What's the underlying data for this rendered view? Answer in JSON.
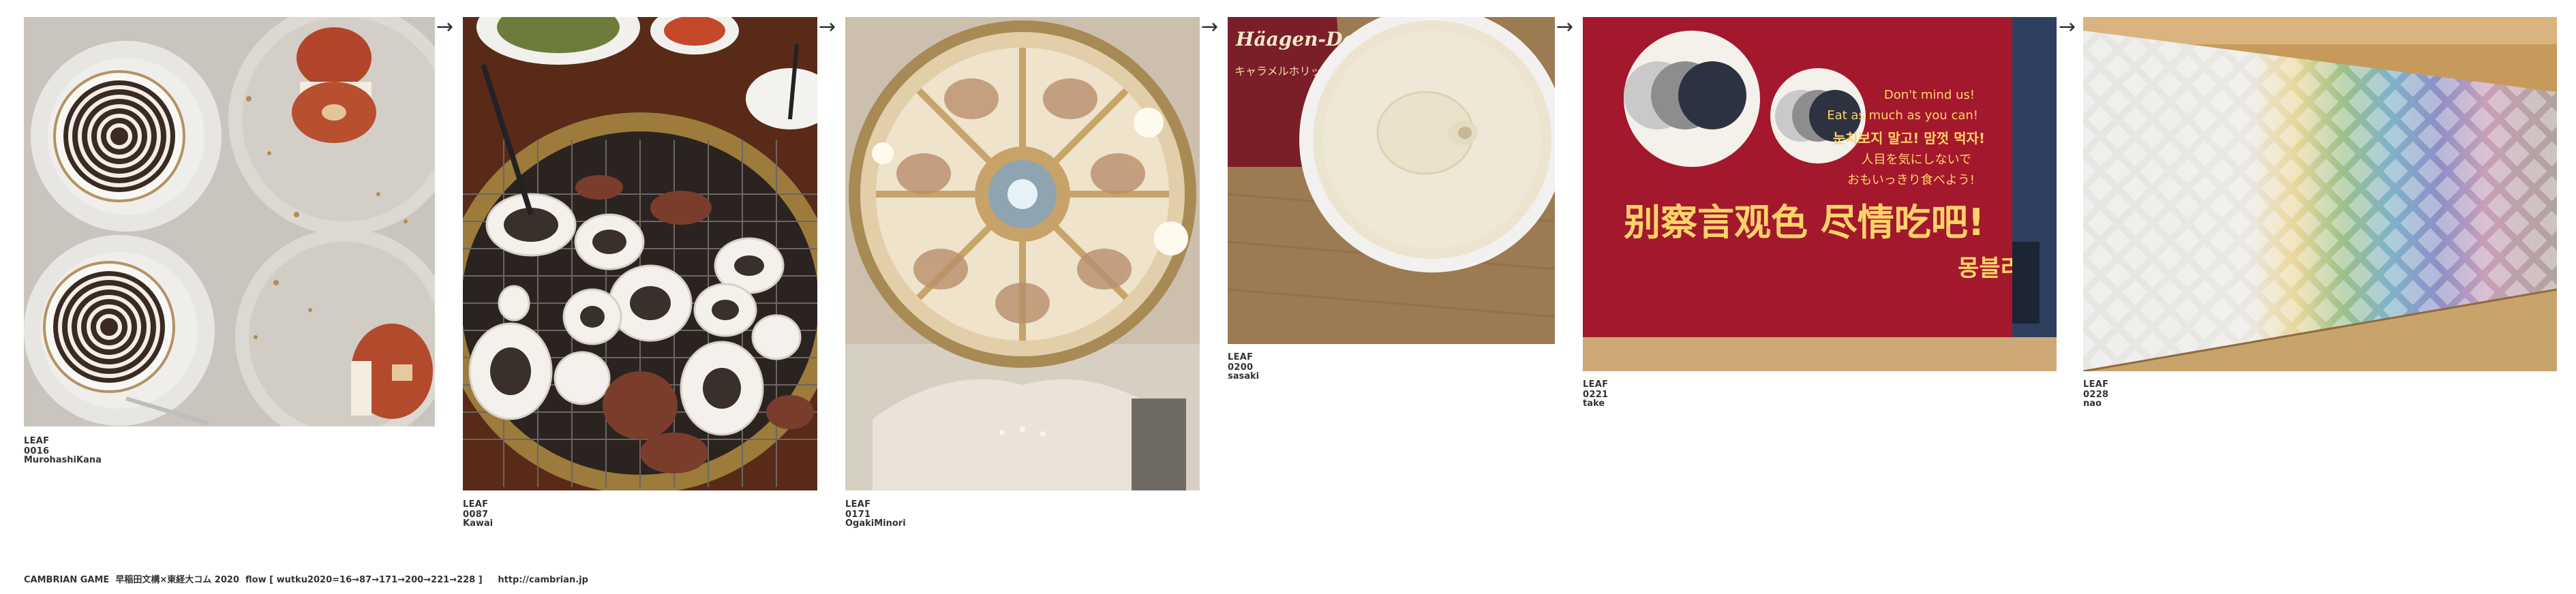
{
  "flow": [
    {
      "leaf": "LEAF 0016",
      "author": "MurohashiKana",
      "image": "latte-art-and-donut-dessert-photo"
    },
    {
      "leaf": "LEAF 0087",
      "author": "Kawai",
      "image": "yakiniku-grill-photo"
    },
    {
      "leaf": "LEAF 0171",
      "author": "OgakiMinori",
      "image": "church-dome-ceiling-photo"
    },
    {
      "leaf": "LEAF 0200",
      "author": "sasaki",
      "image": "haagen-dazs-ice-cream-cup-photo",
      "brand_text": "Häagen-Dazs",
      "label_text": "キャラメルホリック"
    },
    {
      "leaf": "LEAF 0221",
      "author": "take",
      "image": "red-store-sign-photo",
      "sign_lines": [
        "Don't mind us!",
        "Eat as much as you can!",
        "눈치보지 말고! 맘껏 먹자!",
        "人目を気にしないで",
        "おもいっきり食べよう!"
      ],
      "sign_big": "别察言观色 尽情吃吧!",
      "sign_logo": "몽블리"
    },
    {
      "leaf": "LEAF 0228",
      "author": "nao",
      "image": "wall-of-cards-photo"
    }
  ],
  "arrow_glyph": "→",
  "footer": "CAMBRIAN GAME  早稲田文構×東経大コム 2020  flow [ wutku2020=16→87→171→200→221→228 ]     http://cambrian.jp"
}
